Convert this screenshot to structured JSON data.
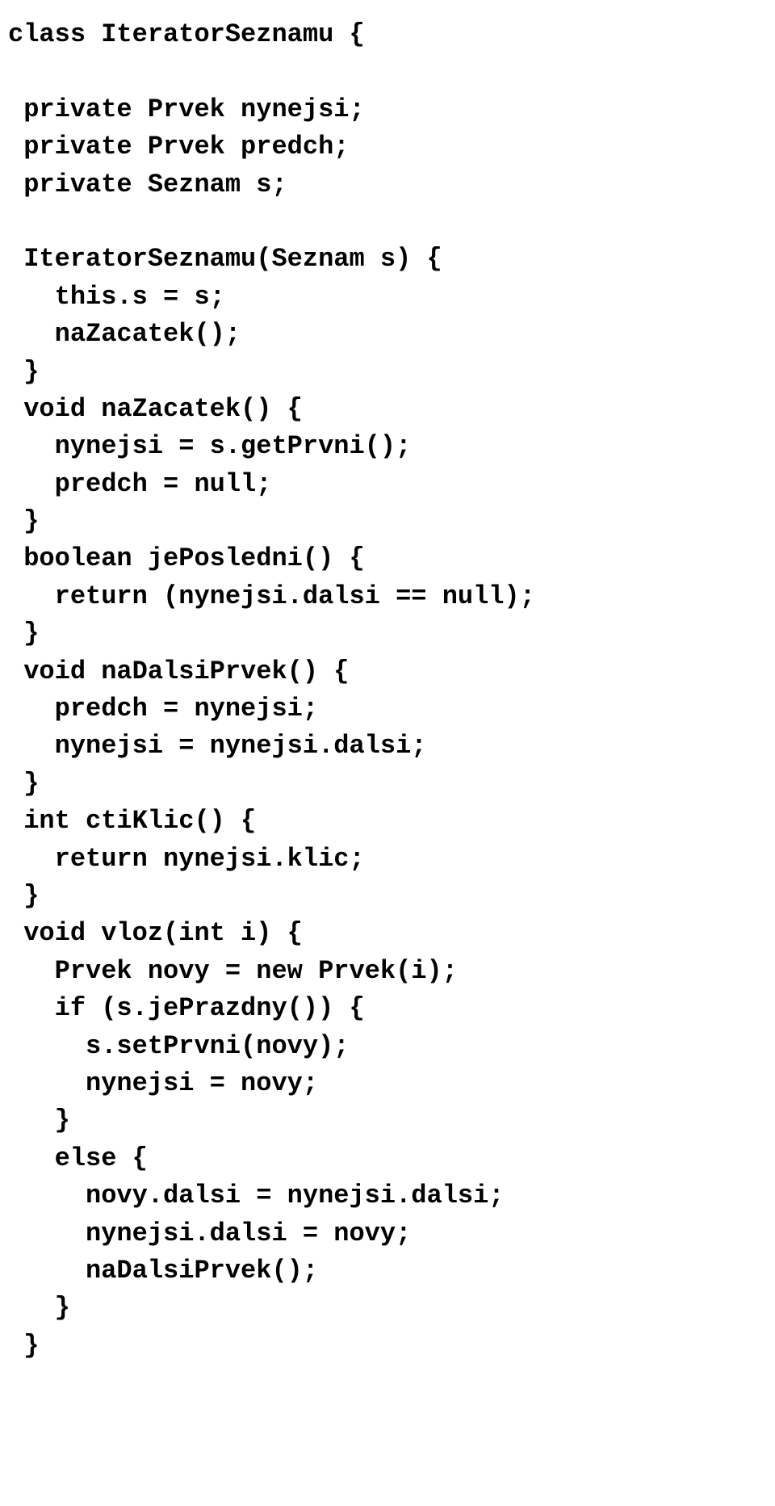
{
  "code_lines": [
    "class IteratorSeznamu {",
    "",
    " private Prvek nynejsi;",
    " private Prvek predch;",
    " private Seznam s;",
    "",
    " IteratorSeznamu(Seznam s) {",
    "   this.s = s;",
    "   naZacatek();",
    " }",
    " void naZacatek() {",
    "   nynejsi = s.getPrvni();",
    "   predch = null;",
    " }",
    " boolean jePosledni() {",
    "   return (nynejsi.dalsi == null);",
    " }",
    " void naDalsiPrvek() {",
    "   predch = nynejsi;",
    "   nynejsi = nynejsi.dalsi;",
    " }",
    " int ctiKlic() {",
    "   return nynejsi.klic;",
    " }",
    " void vloz(int i) {",
    "   Prvek novy = new Prvek(i);",
    "   if (s.jePrazdny()) {",
    "     s.setPrvni(novy);",
    "     nynejsi = novy;",
    "   }",
    "   else {",
    "     novy.dalsi = nynejsi.dalsi;",
    "     nynejsi.dalsi = novy;",
    "     naDalsiPrvek();",
    "   }",
    " }"
  ]
}
